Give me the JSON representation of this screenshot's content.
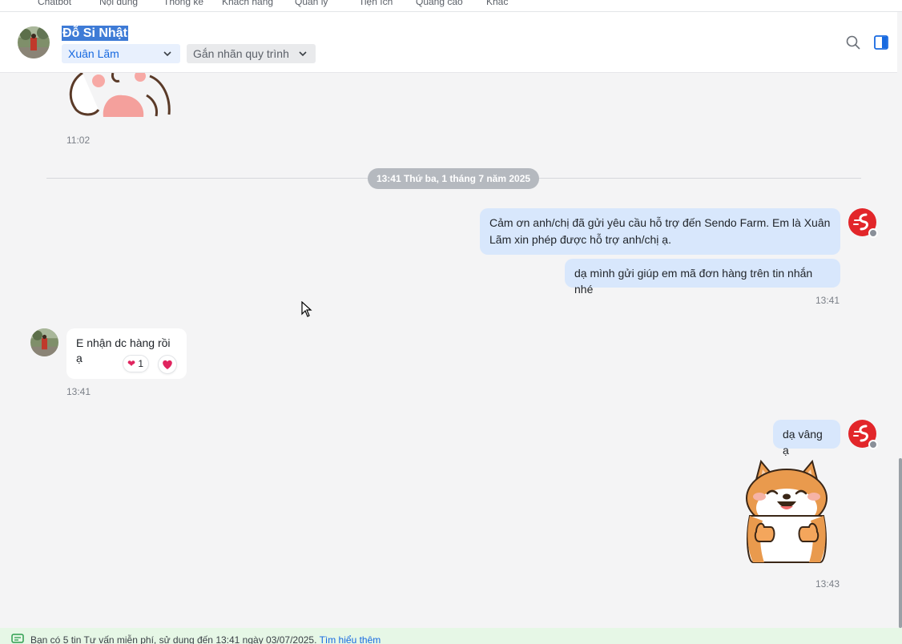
{
  "top_nav": {
    "items": [
      "Chatbot",
      "Nội dung",
      "Thống kê",
      "Khách hàng",
      "Quản lý",
      "Tiện ích",
      "Quảng cáo",
      "Khác"
    ]
  },
  "header": {
    "contact_name": "Đỗ Si Nhật",
    "assignee": "Xuân Lãm",
    "tag_label": "Gắn nhãn quy trình",
    "icons": [
      "search-icon",
      "side-panel-icon"
    ]
  },
  "chat": {
    "sticker_time_1": "11:02",
    "date_separator": "13:41 Thứ ba, 1 tháng 7 năm 2025",
    "out_msg_1": "Cảm ơn anh/chị đã gửi yêu cầu hỗ trợ đến Sendo Farm. Em là Xuân Lãm xin phép được hỗ trợ anh/chị ạ.",
    "out_msg_2": "dạ mình gửi giúp em mã đơn hàng trên tin nhắn nhé",
    "out_time_1": "13:41",
    "in_msg_1": "E nhận dc hàng rồi ạ",
    "reaction_count": "1",
    "in_time_1": "13:41",
    "out_msg_3": "dạ vâng ạ",
    "out_time_2": "13:43"
  },
  "footer": {
    "notice": "Bạn có 5 tin Tư vấn miễn phí, sử dụng đến 13:41 ngày 03/07/2025.",
    "link": "Tìm hiểu thêm"
  },
  "colors": {
    "accent": "#1769e0",
    "outgoing_bubble": "#d8e7fc",
    "sendo_red": "#e2262a",
    "footer_bg": "#e6f7e6"
  }
}
